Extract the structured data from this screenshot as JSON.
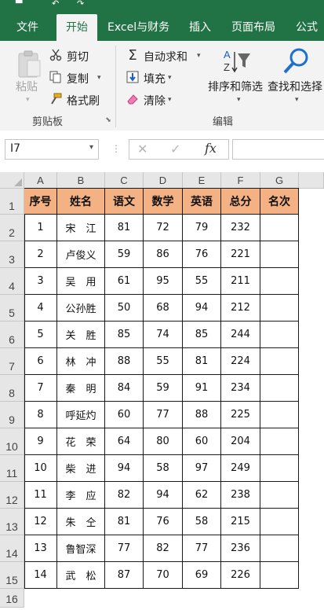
{
  "ribbon_tabs": [
    {
      "label": "文件"
    },
    {
      "label": "开始"
    },
    {
      "label": "Excel与财务"
    },
    {
      "label": "插入"
    },
    {
      "label": "页面布局"
    },
    {
      "label": "公式"
    }
  ],
  "clipboard": {
    "paste_label": "粘贴",
    "cut_label": "剪切",
    "copy_label": "复制",
    "format_painter_label": "格式刷",
    "group_label": "剪贴板"
  },
  "editing": {
    "autosum_label": "自动求和",
    "fill_label": "填充",
    "clear_label": "清除",
    "sort_filter_label": "排序和筛选",
    "find_select_label": "查找和选择",
    "group_label": "编辑"
  },
  "formula_bar": {
    "name_box": "I7",
    "fx_label": "fx",
    "formula": ""
  },
  "columns": [
    "A",
    "B",
    "C",
    "D",
    "E",
    "F",
    "G"
  ],
  "rows": [
    "1",
    "2",
    "3",
    "4",
    "5",
    "6",
    "7",
    "8",
    "9",
    "10",
    "11",
    "12",
    "13",
    "14",
    "15",
    "16"
  ],
  "table": {
    "headers": [
      "序号",
      "姓名",
      "语文",
      "数学",
      "英语",
      "总分",
      "名次"
    ],
    "data": [
      [
        "1",
        "宋　江",
        "81",
        "72",
        "79",
        "232",
        ""
      ],
      [
        "2",
        "卢俊义",
        "59",
        "86",
        "76",
        "221",
        ""
      ],
      [
        "3",
        "吴　用",
        "61",
        "95",
        "55",
        "211",
        ""
      ],
      [
        "4",
        "公孙胜",
        "50",
        "68",
        "94",
        "212",
        ""
      ],
      [
        "5",
        "关　胜",
        "85",
        "74",
        "85",
        "244",
        ""
      ],
      [
        "6",
        "林　冲",
        "88",
        "55",
        "81",
        "224",
        ""
      ],
      [
        "7",
        "秦　明",
        "84",
        "59",
        "91",
        "234",
        ""
      ],
      [
        "8",
        "呼延灼",
        "60",
        "77",
        "88",
        "225",
        ""
      ],
      [
        "9",
        "花　荣",
        "64",
        "80",
        "60",
        "204",
        ""
      ],
      [
        "10",
        "柴　进",
        "94",
        "58",
        "97",
        "249",
        ""
      ],
      [
        "11",
        "李　应",
        "82",
        "94",
        "62",
        "238",
        ""
      ],
      [
        "12",
        "朱　仝",
        "81",
        "76",
        "58",
        "215",
        ""
      ],
      [
        "13",
        "鲁智深",
        "77",
        "82",
        "77",
        "236",
        ""
      ],
      [
        "14",
        "武　松",
        "87",
        "70",
        "69",
        "226",
        ""
      ]
    ]
  },
  "colors": {
    "ribbon_green": "#217346",
    "header_fill": "#f4b183"
  }
}
